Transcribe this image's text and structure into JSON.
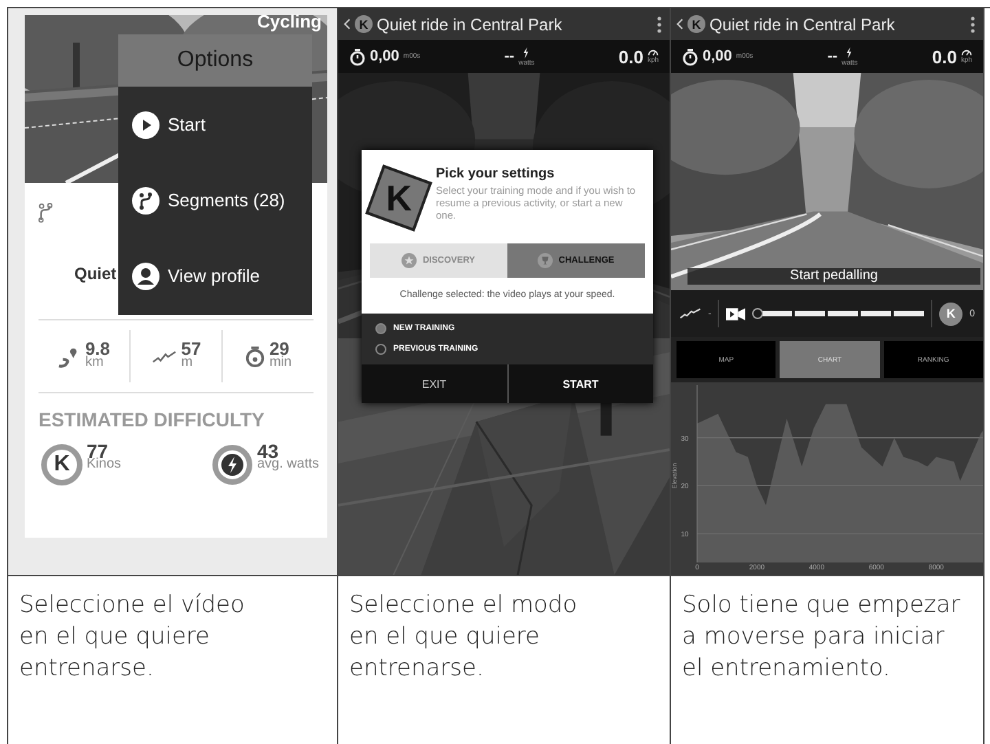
{
  "video_list_screen": {
    "category": "Cycling",
    "route_title": "Quiet",
    "options_menu": {
      "title": "Options",
      "items": [
        {
          "kind": "start",
          "label": "Start"
        },
        {
          "kind": "segments",
          "label": "Segments (28)"
        },
        {
          "kind": "profile",
          "label": "View profile"
        }
      ]
    },
    "stats": [
      {
        "kind": "distance",
        "value": "9.8",
        "unit": "km"
      },
      {
        "kind": "elevation",
        "value": "57",
        "unit": "m"
      },
      {
        "kind": "duration",
        "value": "29",
        "unit": "min"
      }
    ],
    "difficulty": {
      "heading": "ESTIMATED DIFFICULTY",
      "items": [
        {
          "kind": "kinos",
          "badge": "K",
          "value": "77",
          "unit": "Kinos"
        },
        {
          "kind": "power",
          "value": "43",
          "unit": "avg. watts"
        }
      ]
    }
  },
  "settings_screen": {
    "logo": "K",
    "title": "Quiet ride in Central Park",
    "stats": {
      "time": "0,00",
      "time_unit": "m00s",
      "power": "--",
      "power_unit": "watts",
      "speed": "0.0",
      "speed_unit": "kph"
    },
    "dialog": {
      "logo": "K",
      "title": "Pick your settings",
      "text": "Select your training mode and if you wish to resume a previous activity, or start a new one.",
      "modes": [
        {
          "kind": "discovery",
          "label": "DISCOVERY",
          "selected": false
        },
        {
          "kind": "challenge",
          "label": "CHALLENGE",
          "selected": true
        }
      ],
      "note": "Challenge selected: the video plays at your speed.",
      "options": [
        {
          "label": "NEW TRAINING",
          "selected": true
        },
        {
          "label": "PREVIOUS TRAINING",
          "selected": false
        }
      ],
      "buttons": [
        {
          "kind": "secondary",
          "label": "EXIT"
        },
        {
          "kind": "primary",
          "label": "START"
        }
      ]
    }
  },
  "ride_screen": {
    "logo": "K",
    "title": "Quiet ride in Central Park",
    "stats": {
      "time": "0,00",
      "time_unit": "m00s",
      "power": "--",
      "power_unit": "watts",
      "speed": "0.0",
      "speed_unit": "kph"
    },
    "banner": "Start pedalling",
    "elevation_reading": "-",
    "progress": {
      "level": 0
    },
    "score_logo": "K",
    "score": "0",
    "tabs": [
      {
        "label": "MAP",
        "selected": false
      },
      {
        "label": "CHART",
        "selected": true
      },
      {
        "label": "RANKING",
        "selected": false
      }
    ],
    "chart_data": {
      "type": "area",
      "ylabel": "Elevation",
      "xlim": [
        0,
        9800
      ],
      "ylim": [
        4,
        41
      ],
      "xticks": [
        0,
        2000,
        4000,
        6000,
        8000
      ],
      "yticks": [
        10,
        20,
        30
      ],
      "x": [
        0,
        700,
        1300,
        1700,
        2000,
        2300,
        3000,
        3500,
        3900,
        4300,
        5000,
        5500,
        6200,
        6600,
        6900,
        7400,
        7700,
        8000,
        8600,
        8800,
        9500,
        9800
      ],
      "grid": true,
      "series": [
        {
          "color": "#5a5a5a",
          "values": [
            33,
            35,
            27,
            26,
            20,
            16,
            34,
            24,
            32,
            37,
            37,
            28,
            24,
            30,
            26,
            25,
            24,
            26,
            25,
            21,
            31,
            33
          ]
        }
      ]
    }
  },
  "captions": [
    "Seleccione el vídeo en el que quiere entrenarse.",
    "Seleccione el modo en el que quiere entrenarse.",
    "Solo tiene que empezar a moverse para iniciar el entrenamiento."
  ]
}
